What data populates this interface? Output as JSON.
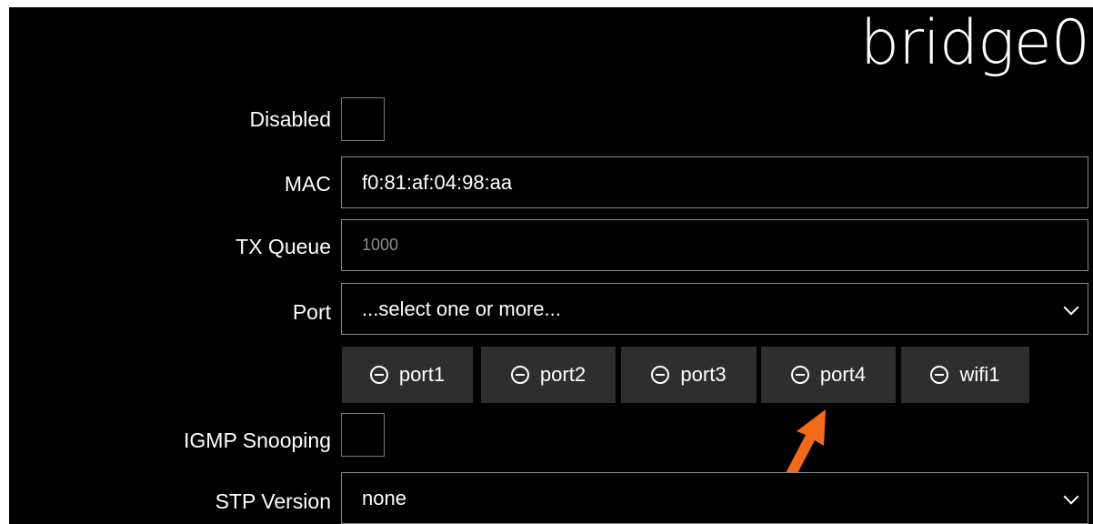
{
  "header": {
    "title": "bridge0"
  },
  "form": {
    "disabled": {
      "label": "Disabled",
      "checked": false
    },
    "mac": {
      "label": "MAC",
      "value": "f0:81:af:04:98:aa"
    },
    "tx_queue": {
      "label": "TX Queue",
      "placeholder": "1000"
    },
    "port": {
      "label": "Port",
      "placeholder": "...select one or more...",
      "selected": [
        "port1",
        "port2",
        "port3",
        "port4",
        "wifi1"
      ]
    },
    "igmp_snooping": {
      "label": "IGMP Snooping",
      "checked": false
    },
    "stp_version": {
      "label": "STP Version",
      "value": "none"
    }
  },
  "icons": {
    "remove": "minus-circle-icon",
    "dropdown": "chevron-down-icon",
    "annotation": "arrow-icon"
  },
  "colors": {
    "background": "#000000",
    "tag_bg": "#2e2e2e",
    "annotation_arrow": "#f26b1d"
  }
}
